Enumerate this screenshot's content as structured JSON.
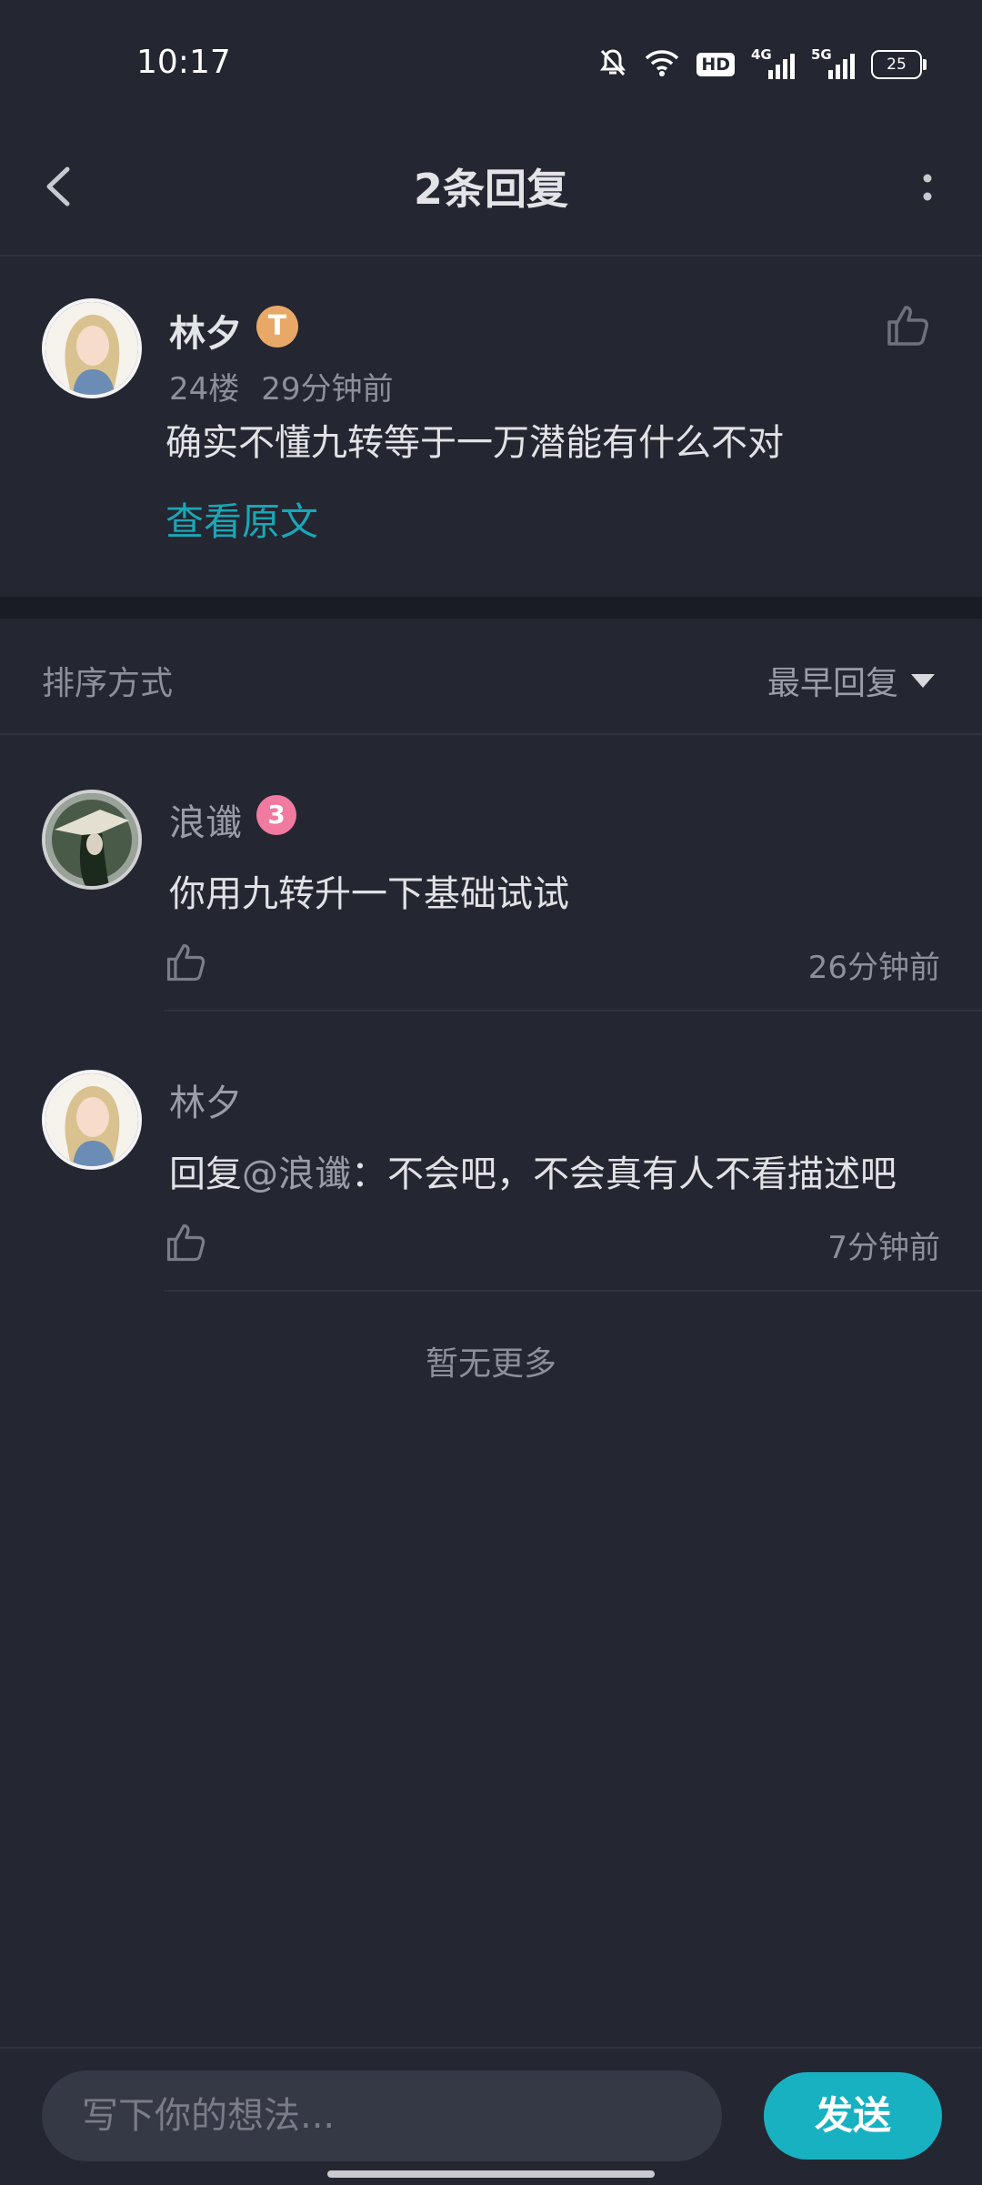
{
  "status_bar": {
    "time": "10:17",
    "hd_label": "HD",
    "net1_label": "4G",
    "net2_label": "5G",
    "battery": "25",
    "icons": [
      "bell-off-icon",
      "wifi-icon",
      "hd-icon",
      "signal-4g-icon",
      "signal-5g-icon",
      "battery-icon"
    ]
  },
  "header": {
    "title": "2条回复",
    "back_icon": "chevron-left-icon",
    "more_icon": "more-vertical-icon"
  },
  "main_comment": {
    "username": "林夕",
    "badge": "T",
    "floor": "24楼",
    "time": "29分钟前",
    "content": "确实不懂九转等于一万潜能有什么不对",
    "view_original": "查看原文",
    "like_icon": "thumbs-up-icon"
  },
  "sort": {
    "label": "排序方式",
    "selected": "最早回复",
    "dropdown_icon": "triangle-down-icon"
  },
  "replies": [
    {
      "username": "浪谶",
      "badge": "3",
      "content": "你用九转升一下基础试试",
      "time": "26分钟前"
    },
    {
      "username": "林夕",
      "reply_prefix": "回复",
      "mention": "@浪谶",
      "content": "：不会吧，不会真有人不看描述吧",
      "time": "7分钟前"
    }
  ],
  "footer_note": "暂无更多",
  "composer": {
    "placeholder": "写下你的想法...",
    "value": "",
    "send_label": "发送"
  },
  "colors": {
    "background": "#242631",
    "accent": "#18b1c2",
    "link": "#1aa7b6",
    "muted_text": "#8d8f99"
  }
}
